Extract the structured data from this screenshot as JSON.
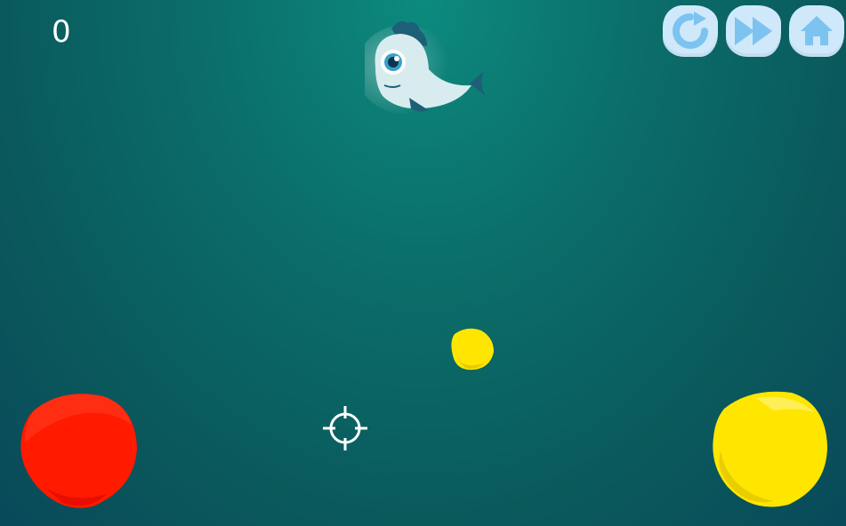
{
  "hud": {
    "score": "0"
  },
  "buttons": [
    {
      "name": "restart-button",
      "icon": "restart-icon"
    },
    {
      "name": "next-button",
      "icon": "fast-forward-icon"
    },
    {
      "name": "home-button",
      "icon": "home-icon"
    }
  ],
  "colors": {
    "water_top": "#0c8a7e",
    "water_bottom": "#09495a",
    "button_bg": "#cfe9fb",
    "button_icon": "#7cc3f0",
    "red_blob": "#ff1a00",
    "yellow_blob": "#ffe600",
    "fish_body": "#d8ecef"
  },
  "objects": [
    "fish-character",
    "red-blob",
    "yellow-blob-small",
    "yellow-blob-big",
    "crosshair-cursor"
  ]
}
